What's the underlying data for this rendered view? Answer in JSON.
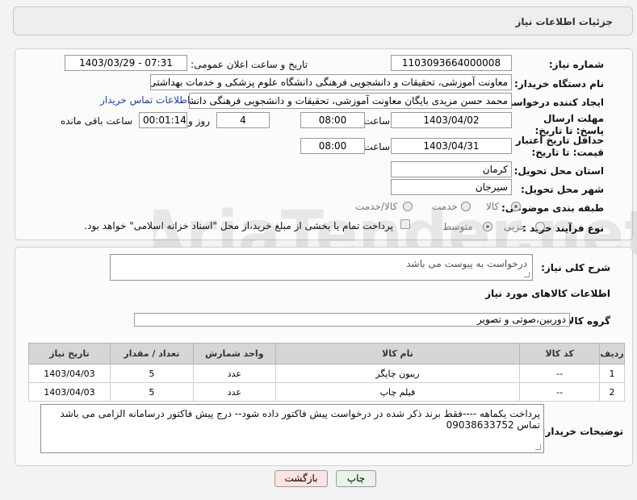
{
  "header": {
    "title": "جزئیات اطلاعات نیاز"
  },
  "fields": {
    "need_number_label": "شماره نیاز:",
    "need_number": "1103093664000008",
    "announce_label": "تاریخ و ساعت اعلان عمومی:",
    "announce_value": "1403/03/29 - 07:31",
    "buyer_org_label": "نام دستگاه خریدار:",
    "buyer_org": "معاونت آموزشی، تحقیقات و دانشجویی فرهنگی دانشگاه علوم پزشکی و خدمات بهداشتی",
    "requester_label": "ایجاد کننده درخواست:",
    "requester": "محمد حسن  مزیدی بایگان معاونت آموزشی، تحقیقات و دانشجویی فرهنگی دانشگاه",
    "buyer_contact_link": "اطلاعات تماس خریدار",
    "deadline_label": "مهلت ارسال پاسخ: تا تاریخ:",
    "deadline_date": "1403/04/02",
    "time_label": "ساعت",
    "deadline_time": "08:00",
    "days_value": "4",
    "days_label": "روز و",
    "remaining_time": "00:01:14",
    "remaining_label": "ساعت باقی مانده",
    "validity_label": "حداقل تاریخ اعتبار قیمت: تا تاریخ:",
    "validity_date": "1403/04/31",
    "validity_time": "08:00",
    "province_label": "استان محل تحویل:",
    "province": "کرمان",
    "city_label": "شهر محل تحویل:",
    "city": "سیرجان",
    "category_label": "طبقه بندی موضوعی:",
    "category_options": [
      "کالا",
      "خدمت",
      "کالا/خدمت"
    ],
    "process_label": "نوع فرآیند خرید :",
    "process_options": [
      "جزیی",
      "متوسط"
    ],
    "payment_note": "پرداخت تمام یا بخشی از مبلغ خرید،از محل \"اسناد خزانه اسلامی\" خواهد بود."
  },
  "description": {
    "label": "شرح کلی نیاز:",
    "value": "درخواست به پیوست می باشد"
  },
  "goods": {
    "section_title": "اطلاعات کالاهای مورد نیاز",
    "group_label": "گروه کالا:",
    "group_value": "دوربین،صوتی و تصویر",
    "columns": [
      "ردیف",
      "کد کالا",
      "نام کالا",
      "واحد شمارش",
      "تعداد / مقدار",
      "تاریخ نیاز"
    ],
    "rows": [
      {
        "index": "1",
        "code": "--",
        "name": "ریبون چاپگر",
        "unit": "عدد",
        "qty": "5",
        "date": "1403/04/03"
      },
      {
        "index": "2",
        "code": "--",
        "name": "فیلم چاپ",
        "unit": "عدد",
        "qty": "5",
        "date": "1403/04/03"
      }
    ]
  },
  "buyer_notes": {
    "label": "توضیحات خریدار:",
    "line1": "پرداخت یکماهه ----فقط برند ذکر شده در درخواست  پیش فاکتور داده شود-- درج پیش فاکتور درسامانه الزامی می باشد",
    "line2": "تماس 09038633752"
  },
  "buttons": {
    "print": "چاپ",
    "back": "بازگشت"
  },
  "watermark": "AriaTender.net",
  "colors": {
    "link": "#1a3fb0",
    "back_button_bg": "#fde3e3",
    "print_button_bg": "#eaf3ea"
  }
}
